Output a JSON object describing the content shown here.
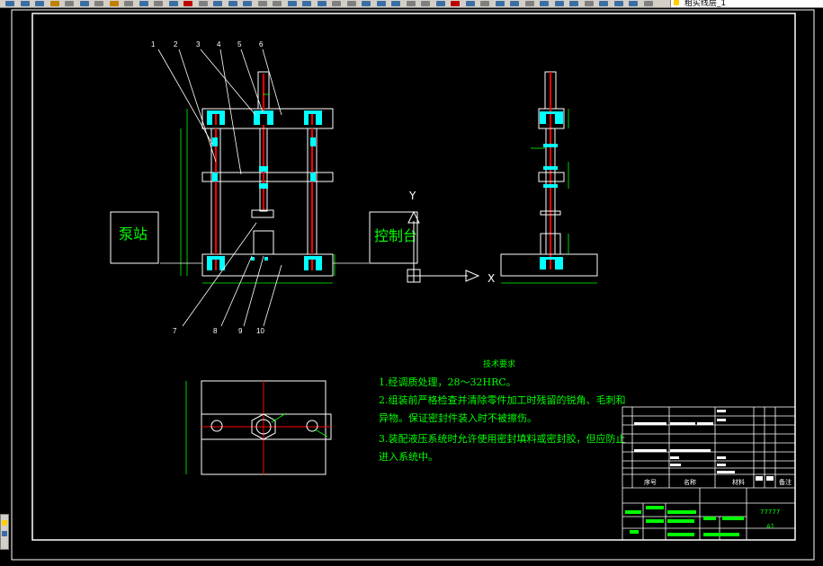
{
  "toolbar": {
    "layer_name": "粗实线层_1",
    "button_colors": [
      "#3a6ea5",
      "#3a6ea5",
      "#3a6ea5",
      "#c08000",
      "#808080",
      "#3a6ea5",
      "#808080",
      "#c08000",
      "#808080",
      "#3a6ea5",
      "#808080",
      "#3a6ea5",
      "#c00000",
      "#808080",
      "#3a6ea5",
      "#3a6ea5",
      "#3a6ea5",
      "#808080",
      "#808080",
      "#3a6ea5",
      "#3a6ea5",
      "#3a6ea5",
      "#808080",
      "#808080",
      "#3a6ea5",
      "#3a6ea5",
      "#3a6ea5",
      "#808080",
      "#808080",
      "#3a6ea5",
      "#c00000",
      "#3a6ea5",
      "#808080",
      "#3a6ea5",
      "#3a6ea5",
      "#808080",
      "#3a6ea5",
      "#3a6ea5",
      "#3a6ea5",
      "#808080",
      "#3a6ea5",
      "#3a6ea5",
      "#3a6ea5",
      "#808080"
    ]
  },
  "drawing": {
    "part_numbers": [
      "1",
      "2",
      "3",
      "4",
      "5",
      "6",
      "7",
      "8",
      "9",
      "10"
    ],
    "pump_station": "泵站",
    "control_console": "控制台",
    "ucs_y": "Y",
    "ucs_x": "X",
    "notes_title": "技术要求",
    "notes": [
      "1.经调质处理，28～32HRC。",
      "2.组装前严格检查并清除零件加工时残留的锐角、毛刺和",
      "异物。保证密封件装入时不被擦伤。",
      "3.装配液压系统时允许使用密封填料或密封胶，但应防止",
      "进入系统中。"
    ],
    "title_block": {
      "col_seq": "序号",
      "col_name": "名称",
      "col_material": "材料",
      "col_remark": "备注",
      "code": "77777",
      "sheet_size": "A1"
    }
  },
  "colors": {
    "background": "#000000",
    "frame": "#ffffff",
    "part_fill": "#00ffff",
    "rod": "#ff0000",
    "text_green": "#00ff00",
    "dimension": "#00ff00"
  }
}
